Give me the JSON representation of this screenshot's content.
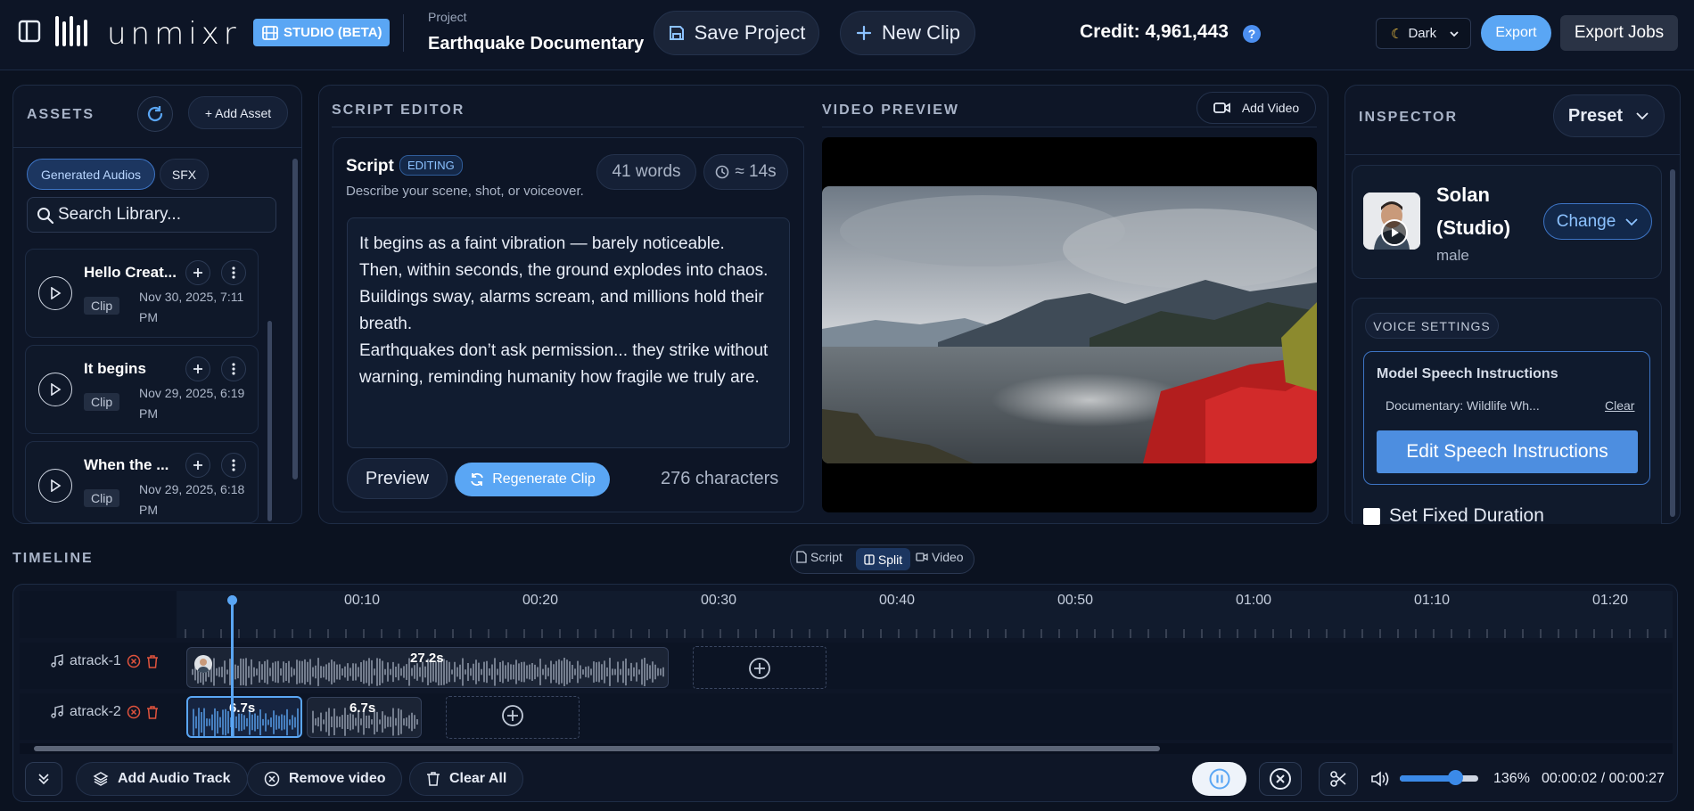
{
  "header": {
    "logo": "unmixr",
    "studio_badge": "STUDIO (BETA)",
    "project_label": "Project",
    "project_name": "Earthquake Documentary",
    "save_project": "Save Project",
    "new_clip": "New Clip",
    "credit": "Credit: 4,961,443",
    "theme": "Dark",
    "export": "Export",
    "export_jobs": "Export Jobs"
  },
  "assets": {
    "title": "ASSETS",
    "add_asset": "+ Add Asset",
    "tabs": [
      "Generated Audios",
      "SFX"
    ],
    "search_placeholder": "Search Library...",
    "items": [
      {
        "title": "Hello Creat...",
        "tag": "Clip",
        "date": "Nov 30, 2025, 7:11 PM"
      },
      {
        "title": "It begins",
        "tag": "Clip",
        "date": "Nov 29, 2025, 6:19 PM"
      },
      {
        "title": "When the ...",
        "tag": "Clip",
        "date": "Nov 29, 2025, 6:18 PM"
      }
    ]
  },
  "script_editor": {
    "title": "SCRIPT EDITOR",
    "script_label": "Script",
    "editing_badge": "EDITING",
    "description": "Describe your scene, shot, or voiceover.",
    "words": "41 words",
    "duration": "≈ 14s",
    "lines": [
      "It begins as a faint vibration — barely noticeable.",
      "Then, within seconds, the ground explodes into chaos.",
      "Buildings sway, alarms scream, and millions hold their",
      "breath.",
      "Earthquakes don’t ask permission... they strike without",
      "warning, reminding humanity how fragile we truly are."
    ],
    "preview": "Preview",
    "regenerate": "Regenerate Clip",
    "characters": "276 characters"
  },
  "video_preview": {
    "title": "VIDEO PREVIEW",
    "add_video": "Add Video"
  },
  "inspector": {
    "title": "INSPECTOR",
    "preset": "Preset",
    "voice_name_1": "Solan",
    "voice_name_2": "(Studio)",
    "voice_gender": "male",
    "change": "Change",
    "voice_settings": "VOICE SETTINGS",
    "model_speech_title": "Model Speech Instructions",
    "instructions_preview": "Documentary: Wildlife Wh...",
    "clear": "Clear",
    "edit_instructions": "Edit Speech Instructions",
    "fixed_duration": "Set Fixed Duration"
  },
  "timeline": {
    "title": "TIMELINE",
    "view_modes": [
      "Script",
      "Split",
      "Video"
    ],
    "active_view": "Split",
    "ticks": [
      "00:10",
      "00:20",
      "00:30",
      "00:40",
      "00:50",
      "01:00",
      "01:10",
      "01:20"
    ],
    "tracks": [
      {
        "name": "atrack-1",
        "clips": [
          "27.2s"
        ]
      },
      {
        "name": "atrack-2",
        "clips": [
          "6.7s",
          "6.7s"
        ]
      }
    ],
    "add_audio_track": "Add Audio Track",
    "remove_video": "Remove video",
    "clear_all": "Clear All",
    "zoom": "136%",
    "time": "00:00:02 / 00:00:27",
    "volume_level": 0.7
  },
  "colors": {
    "accent": "#5aa6f4",
    "background": "#0b1220",
    "panel": "#0e1627",
    "delete_red": "#e0533d"
  }
}
